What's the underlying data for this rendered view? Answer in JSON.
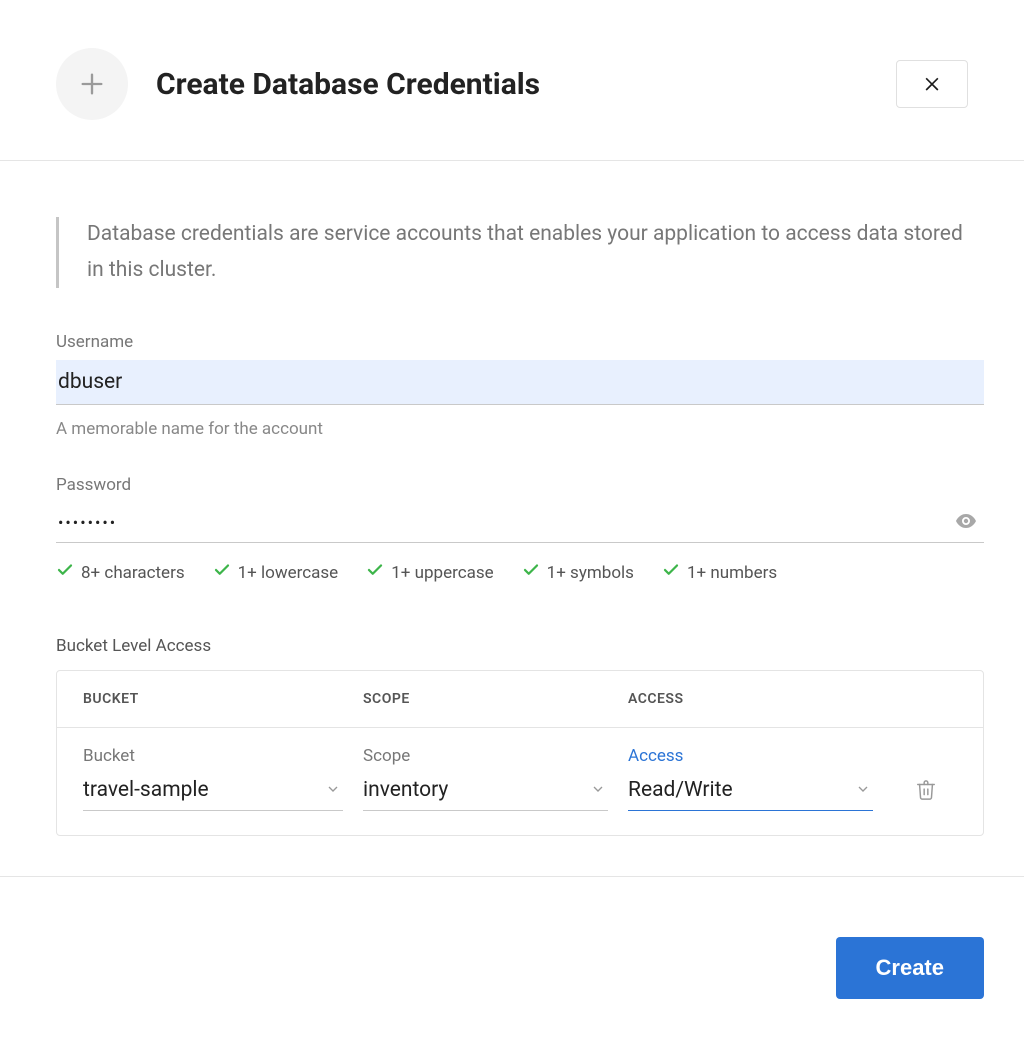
{
  "header": {
    "title": "Create Database Credentials"
  },
  "info_text": "Database credentials are service accounts that enables your application to access data stored in this cluster.",
  "fields": {
    "username": {
      "label": "Username",
      "value": "dbuser",
      "hint": "A memorable name for the account"
    },
    "password": {
      "label": "Password",
      "value": "••••••••"
    }
  },
  "password_checks": [
    "8+ characters",
    "1+ lowercase",
    "1+ uppercase",
    "1+ symbols",
    "1+ numbers"
  ],
  "bucket_access": {
    "section_label": "Bucket Level Access",
    "columns": {
      "bucket": "BUCKET",
      "scope": "SCOPE",
      "access": "ACCESS"
    },
    "row_labels": {
      "bucket": "Bucket",
      "scope": "Scope",
      "access": "Access"
    },
    "row_values": {
      "bucket": "travel-sample",
      "scope": "inventory",
      "access": "Read/Write"
    }
  },
  "footer": {
    "create_label": "Create"
  }
}
